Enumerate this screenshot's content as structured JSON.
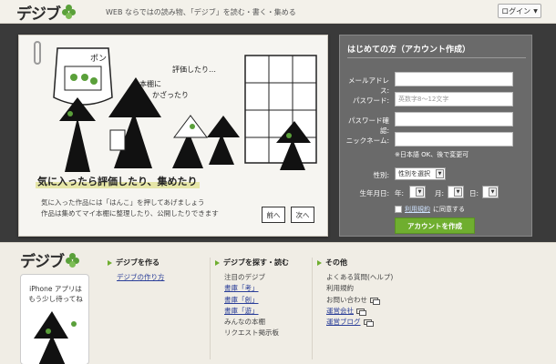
{
  "header": {
    "logo": "デジブ",
    "tagline": "WEB ならではの読み物、「デジブ」を読む・書く・集める",
    "login_label": "ログイン"
  },
  "hero": {
    "headline": "気に入ったら評価したり、集めたり",
    "body_line1": "気に入った作品には「はんこ」を押してあげましょう",
    "body_line2": "作品は集めてマイ本棚に整理したり、公開したりできます",
    "prev_label": "前へ",
    "next_label": "次へ",
    "sketch_text_1": "評価したり…",
    "sketch_text_2": "本棚に",
    "sketch_text_3": "かざったり",
    "sketch_sign": "ポン"
  },
  "signup": {
    "title": "はじめての方（アカウント作成）",
    "email_label": "メールアドレス:",
    "password_label": "パスワード:",
    "password_placeholder": "英数字8～12文字",
    "password_confirm_label": "パスワード確認:",
    "nickname_label": "ニックネーム:",
    "nickname_hint": "※日本語 OK、後で変更可",
    "gender_label": "性別:",
    "gender_value": "性別を選択",
    "dob_label": "生年月日:",
    "year_unit": "年:",
    "month_unit": "月:",
    "day_unit": "日:",
    "tos_link": "利用規約",
    "tos_text": "に同意する",
    "create_button": "アカウントを作成"
  },
  "footer": {
    "logo": "デジブ",
    "iphone_line1": "iPhone アプリは",
    "iphone_line2": "もう少し待ってね",
    "col1": {
      "title": "デジブを作る",
      "items": [
        "デジブの作り方"
      ]
    },
    "col2": {
      "title": "デジブを探す・読む",
      "items": [
        "注目のデジブ",
        "書庫「考」",
        "書庫「創」",
        "書庫「遊」",
        "みんなの本棚",
        "リクエスト掲示板"
      ]
    },
    "col3": {
      "title": "その他",
      "items": [
        "よくある質問(ヘルプ)",
        "利用規約",
        "お問い合わせ",
        "運営会社",
        "運営ブログ"
      ]
    }
  },
  "colors": {
    "accent_green": "#6fae2f",
    "dark_bg": "#3a3a3a",
    "panel_gray": "#6a6a6a",
    "link_blue": "#2b3f99"
  }
}
